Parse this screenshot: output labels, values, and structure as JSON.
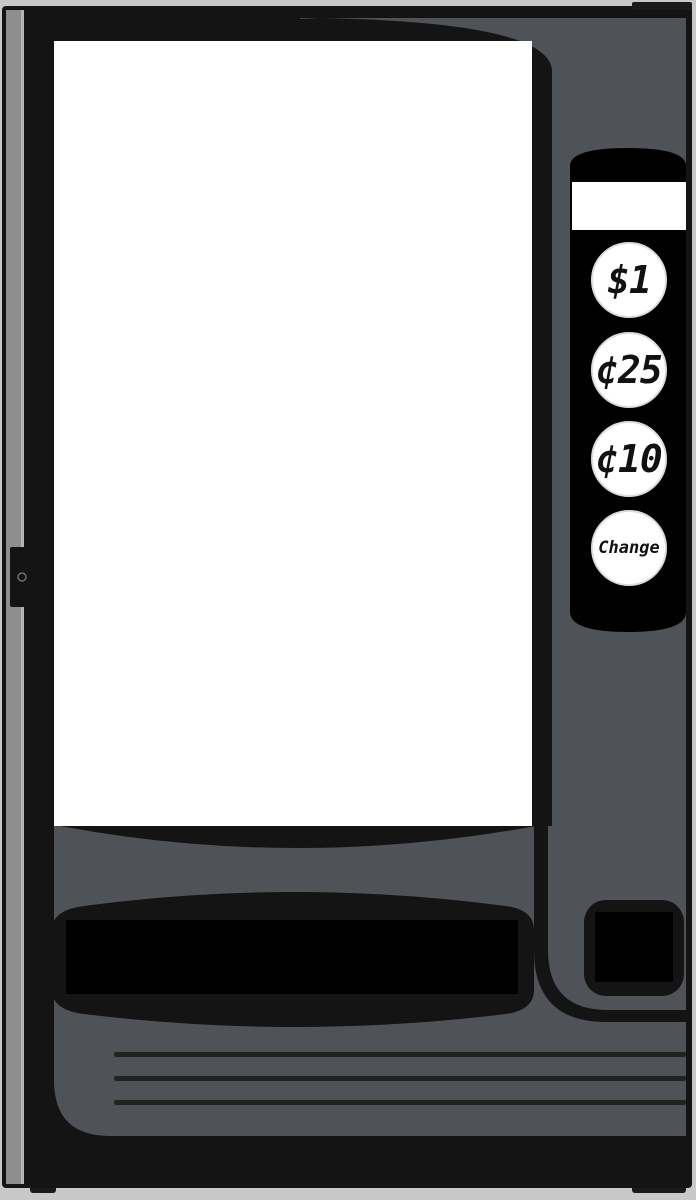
{
  "machine": {
    "body_color": "#4f5358",
    "frame_color": "#141414",
    "door_edge_color": "#8e8e8e"
  },
  "display": {
    "credit_text": ""
  },
  "coin_buttons": [
    {
      "label": "$1",
      "icon": "dollar-coin"
    },
    {
      "label": "¢25",
      "icon": "quarter-coin"
    },
    {
      "label": "¢10",
      "icon": "dime-coin"
    },
    {
      "label": "Change",
      "icon": "change-return"
    }
  ]
}
